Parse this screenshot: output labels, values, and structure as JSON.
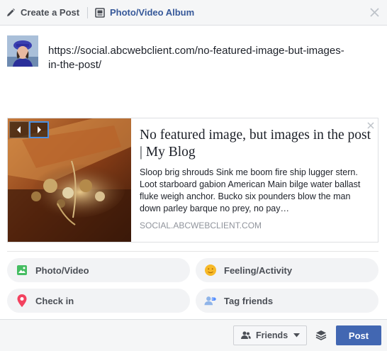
{
  "header": {
    "create_post_label": "Create a Post",
    "photo_album_label": "Photo/Video Album"
  },
  "composer": {
    "text": "https://social.abcwebclient.com/no-featured-image-but-images-in-the-post/"
  },
  "link_preview": {
    "title": "No featured image, but images in the post | My Blog",
    "description": "Sloop brig shrouds Sink me boom fire ship lugger stern. Loot starboard gabion American Main bilge water ballast fluke weigh anchor. Bucko six pounders blow the man down parley barque no prey, no pay…",
    "domain": "SOCIAL.ABCWEBCLIENT.COM"
  },
  "actions": {
    "photo_video": "Photo/Video",
    "feeling_activity": "Feeling/Activity",
    "check_in": "Check in",
    "tag_friends": "Tag friends"
  },
  "footer": {
    "audience": "Friends",
    "post_label": "Post"
  },
  "colors": {
    "brand_blue": "#4267b2",
    "link_blue": "#365899",
    "photo_green": "#45bd62",
    "feeling_yellow": "#f7b928",
    "checkin_red": "#f3425f",
    "tag_blue": "#1877f2"
  },
  "icons": {
    "create_post": "pencil-icon",
    "album": "photo-album-icon",
    "close": "close-icon",
    "prev": "chevron-left-icon",
    "next": "chevron-right-icon",
    "remove_preview": "close-icon",
    "photo": "photo-icon",
    "feeling": "smiley-icon",
    "checkin": "location-pin-icon",
    "tag": "tag-friends-icon",
    "friends": "friends-icon",
    "caret": "caret-down-icon",
    "layers": "layers-icon"
  }
}
